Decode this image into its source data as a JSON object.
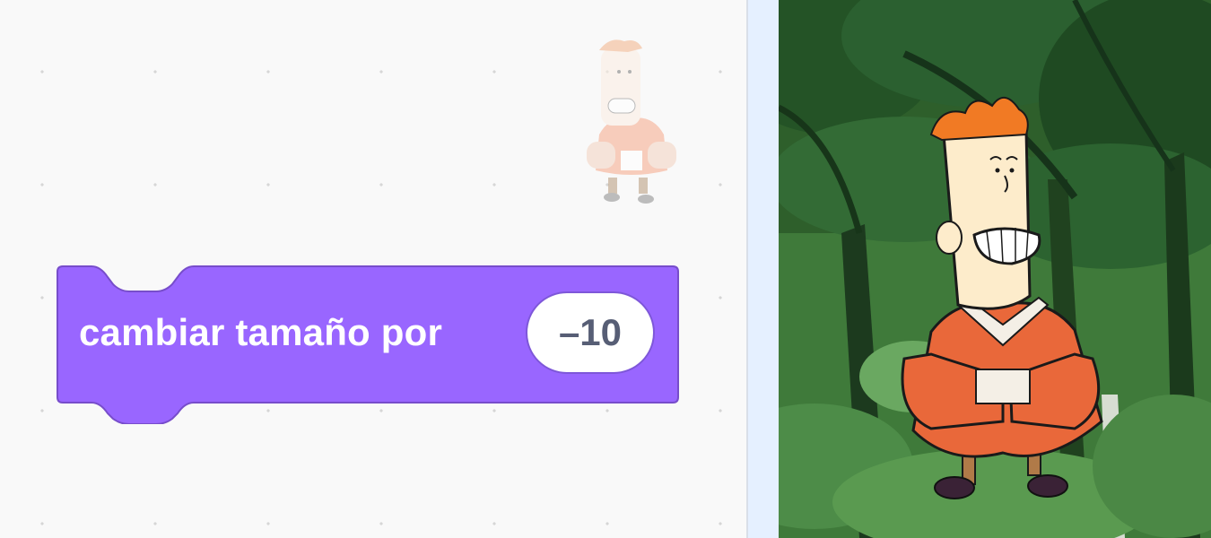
{
  "workspace": {
    "block": {
      "label": "cambiar tamaño por",
      "input_value": "–10",
      "category_color": "#9966ff",
      "category_border": "#774dcb"
    },
    "sprite_preview": {
      "icon": "sprite-thumbnail-icon"
    }
  },
  "stage": {
    "background": "forest-backdrop",
    "sprite": "boy-character-sprite"
  }
}
